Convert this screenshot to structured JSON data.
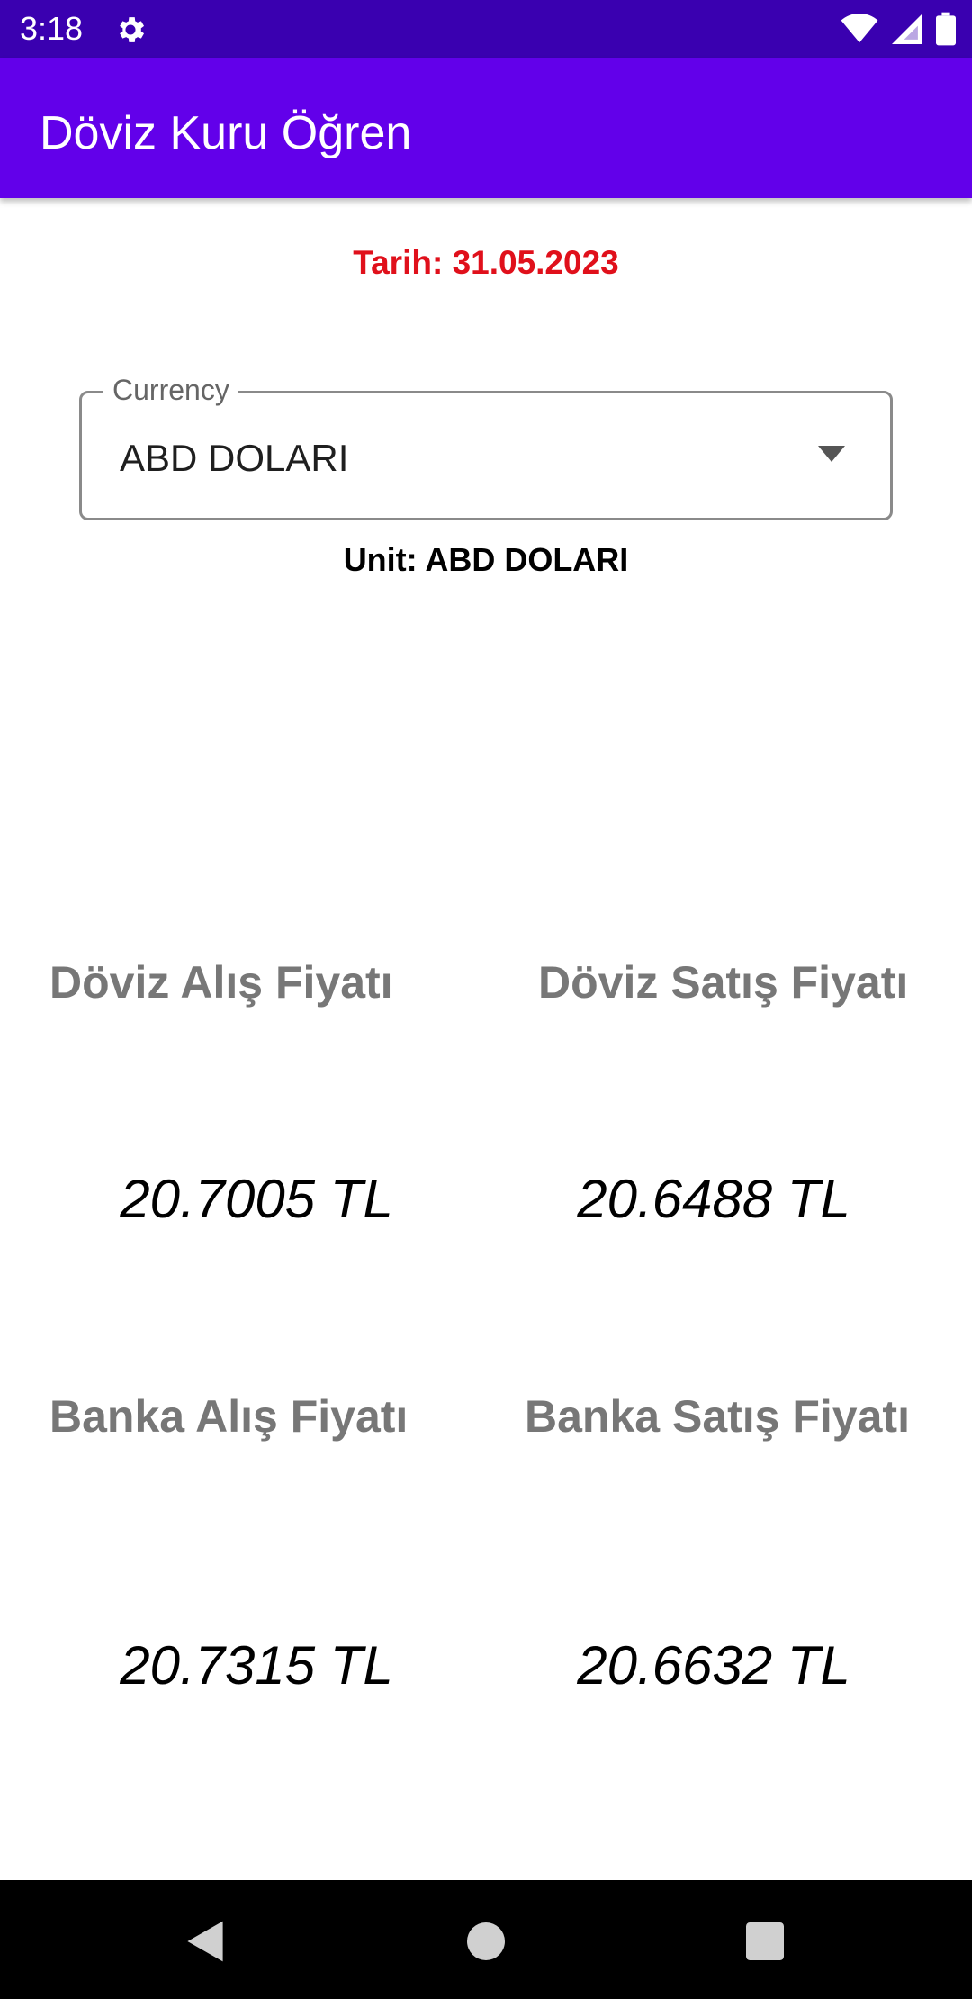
{
  "status_bar": {
    "time": "3:18",
    "icons": [
      "gear-icon",
      "wifi-icon",
      "signal-icon",
      "battery-icon"
    ]
  },
  "app_bar": {
    "title": "Döviz Kuru Öğren"
  },
  "date_text": "Tarih: 31.05.2023",
  "currency": {
    "label": "Currency",
    "selected": "ABD DOLARI"
  },
  "unit_text": "Unit: ABD DOLARI",
  "prices": {
    "doviz_alis": {
      "label": "Döviz Alış Fiyatı",
      "value": "20.7005 TL"
    },
    "doviz_satis": {
      "label": "Döviz Satış Fiyatı",
      "value": "20.6488 TL"
    },
    "banka_alis": {
      "label": "Banka Alış Fiyatı",
      "value": "20.7315 TL"
    },
    "banka_satis": {
      "label": "Banka Satış Fiyatı",
      "value": "20.6632 TL"
    }
  },
  "colors": {
    "status_bar": "#3a00b0",
    "app_bar": "#6200ea",
    "date_text": "#e0101b",
    "label_gray": "#777777"
  },
  "nav_bar": {
    "buttons": [
      "back-icon",
      "home-icon",
      "recents-icon"
    ]
  }
}
